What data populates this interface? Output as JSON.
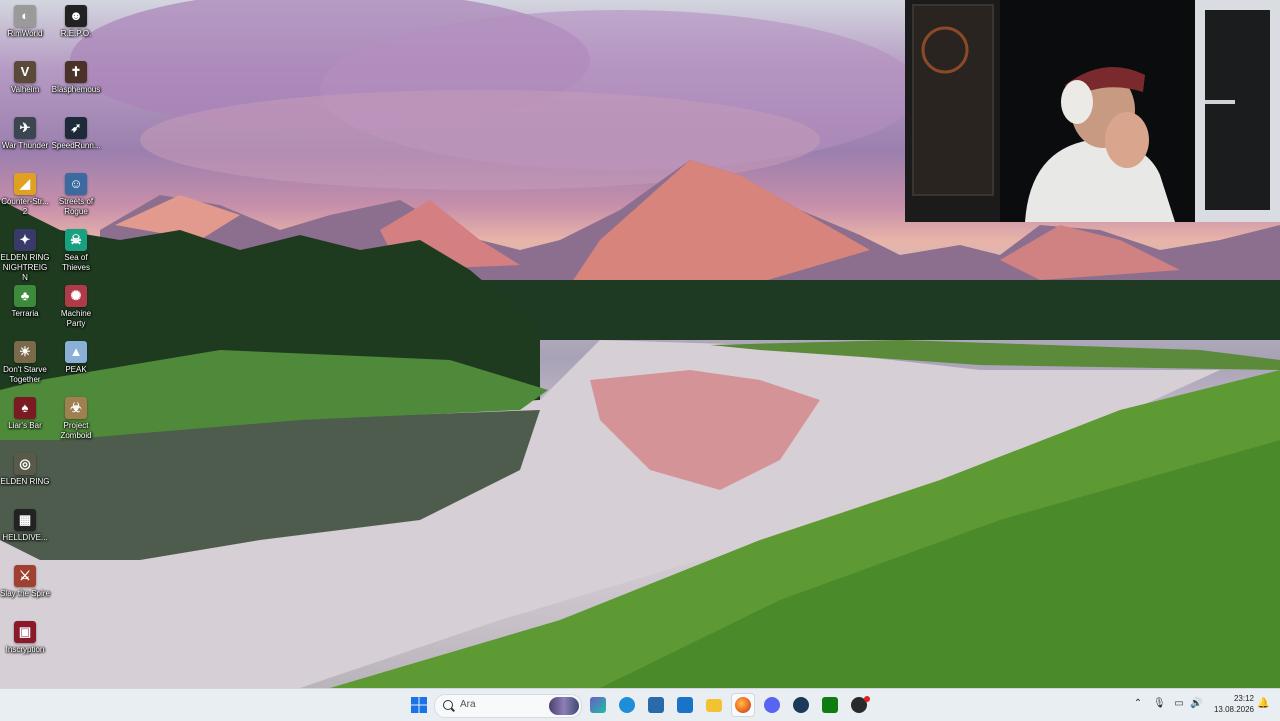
{
  "desktop_icons": [
    {
      "label": "RimWorld",
      "icon": "rimworld-icon",
      "color": "#9a9a9a",
      "glyph": "◐"
    },
    {
      "label": "R.E.P.O.",
      "icon": "repo-icon",
      "color": "#222222",
      "glyph": "☻"
    },
    {
      "label": "Valheim",
      "icon": "valheim-icon",
      "color": "#5a4a38",
      "glyph": "V"
    },
    {
      "label": "Blasphemous",
      "icon": "blasphemous-icon",
      "color": "#4a3228",
      "glyph": "✝"
    },
    {
      "label": "War Thunder",
      "icon": "war-thunder-icon",
      "color": "#3c4650",
      "glyph": "✈"
    },
    {
      "label": "SpeedRunn...",
      "icon": "speedrunners-icon",
      "color": "#1e2a3a",
      "glyph": "➶"
    },
    {
      "label": "Counter-Str... 2",
      "icon": "counter-strike-icon",
      "color": "#e0a020",
      "glyph": "◢"
    },
    {
      "label": "Streets of Rogue",
      "icon": "streets-of-rogue-icon",
      "color": "#3a6aa0",
      "glyph": "☺"
    },
    {
      "label": "ELDEN RING NIGHTREIGN",
      "icon": "nightreign-icon",
      "color": "#3a3a6a",
      "glyph": "✦"
    },
    {
      "label": "Sea of Thieves",
      "icon": "sea-of-thieves-icon",
      "color": "#18a080",
      "glyph": "☠"
    },
    {
      "label": "Terraria",
      "icon": "terraria-icon",
      "color": "#3c8a3c",
      "glyph": "♣"
    },
    {
      "label": "Machine Party",
      "icon": "machine-party-icon",
      "color": "#b03a4a",
      "glyph": "✺"
    },
    {
      "label": "Don't Starve Together",
      "icon": "dont-starve-icon",
      "color": "#7a6a4a",
      "glyph": "☀"
    },
    {
      "label": "PEAK",
      "icon": "peak-icon",
      "color": "#8ab0d8",
      "glyph": "▲"
    },
    {
      "label": "Liar's Bar",
      "icon": "liars-bar-icon",
      "color": "#7a1a22",
      "glyph": "♠"
    },
    {
      "label": "Project Zomboid",
      "icon": "project-zomboid-icon",
      "color": "#a08050",
      "glyph": "☣"
    },
    {
      "label": "ELDEN RING",
      "icon": "elden-ring-icon",
      "color": "#5a5a4a",
      "glyph": "◎"
    },
    {
      "label": "HELLDIVE...",
      "icon": "helldivers-icon",
      "color": "#222222",
      "glyph": "▦"
    },
    {
      "label": "Slay the Spire",
      "icon": "slay-the-spire-icon",
      "color": "#a04030",
      "glyph": "⚔"
    },
    {
      "label": "Inscryption",
      "icon": "inscryption-icon",
      "color": "#8a1a2a",
      "glyph": "▣"
    }
  ],
  "taskbar": {
    "start_icon": "windows-start-icon",
    "search_placeholder": "Ara",
    "pinned": [
      {
        "name": "widgets-icon",
        "color": "#6a5acd"
      },
      {
        "name": "edge-icon",
        "color": "#1f8ed8"
      },
      {
        "name": "store-icon",
        "color": "#2a6aa8"
      },
      {
        "name": "outlook-icon",
        "color": "#1a73c8"
      },
      {
        "name": "file-explorer-icon",
        "color": "#f2c230"
      },
      {
        "name": "firefox-icon",
        "color": "#e8641a"
      },
      {
        "name": "discord-icon",
        "color": "#5865f2"
      },
      {
        "name": "steam-icon",
        "color": "#1b3a5a"
      },
      {
        "name": "xbox-icon",
        "color": "#107c10"
      },
      {
        "name": "obs-icon",
        "color": "#2a2a2a"
      }
    ],
    "active_index": 5,
    "tray": {
      "chevron": "chevron-up-icon",
      "mic": "microphone-icon",
      "network": "network-icon",
      "volume": "volume-icon",
      "notification": "notification-icon"
    },
    "clock": {
      "time": "23:12",
      "date": "13.08.2026"
    }
  }
}
